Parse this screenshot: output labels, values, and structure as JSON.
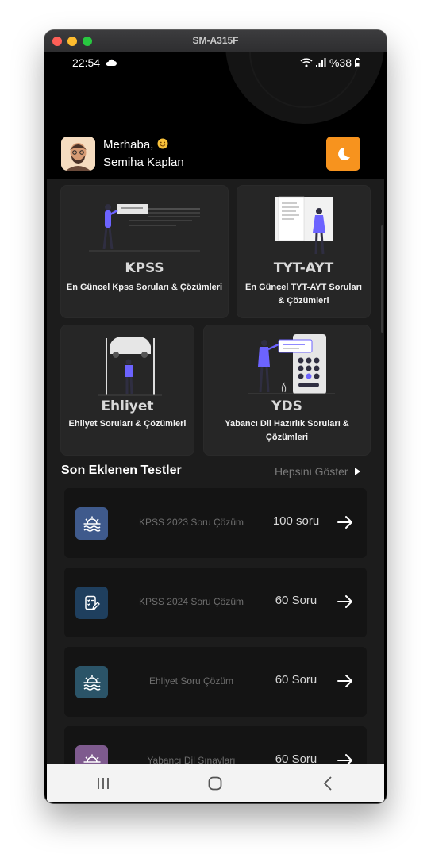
{
  "window": {
    "title": "SM-A315F"
  },
  "status_bar": {
    "time": "22:54",
    "battery": "%38"
  },
  "header": {
    "greeting": "Merhaba,",
    "user_name": "Semiha Kaplan"
  },
  "categories": [
    {
      "title": "KPSS",
      "description": "En Güncel Kpss Soruları & Çözümleri"
    },
    {
      "title": "TYT-AYT",
      "description": "En Güncel TYT-AYT Soruları & Çözümleri"
    },
    {
      "title": "Ehliyet",
      "description": "Ehliyet Soruları & Çözümleri"
    },
    {
      "title": "YDS",
      "description": "Yabancı Dil Hazırlık Soruları & Çözümleri"
    }
  ],
  "recent": {
    "title": "Son Eklenen Testler",
    "see_all": "Hepsini Göster",
    "items": [
      {
        "name": "KPSS 2023 Soru Çözüm",
        "count": "100 soru",
        "icon": "sunset-icon",
        "color": "#3f5a8c"
      },
      {
        "name": "KPSS 2024 Soru Çözüm",
        "count": "60 Soru",
        "icon": "checklist-edit-icon",
        "color": "#1f3f5e"
      },
      {
        "name": "Ehliyet Soru Çözüm",
        "count": "60 Soru",
        "icon": "sunset-icon",
        "color": "#2b5468"
      },
      {
        "name": "Yabancı Dil Sınavları",
        "count": "60 Soru",
        "icon": "sunset-icon",
        "color": "#7e5a8e"
      }
    ]
  },
  "colors": {
    "accent": "#f7931e",
    "illustration": "#6c63ff"
  }
}
